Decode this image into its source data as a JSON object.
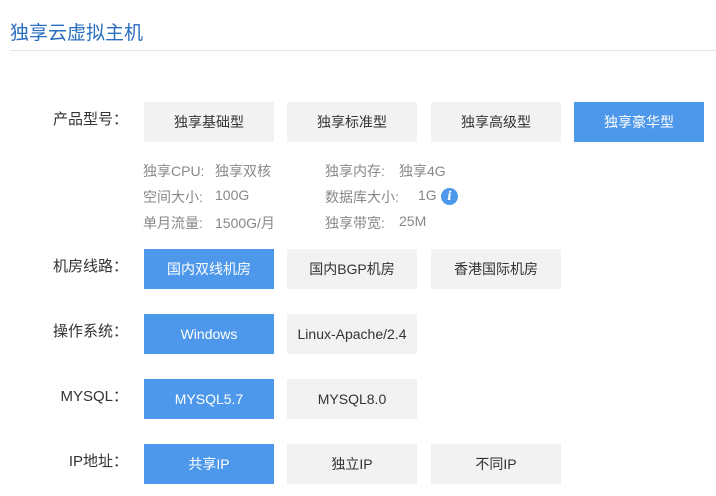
{
  "page": {
    "title": "独享云虚拟主机"
  },
  "product_model": {
    "label": "产品型号：",
    "options": [
      "独享基础型",
      "独享标准型",
      "独享高级型",
      "独享豪华型"
    ],
    "selected": "独享豪华型"
  },
  "specs": {
    "cpu": {
      "label": "独享CPU:",
      "value": "独享双核"
    },
    "memory": {
      "label": "独享内存:",
      "value": "独享4G"
    },
    "space": {
      "label": "空间大小:",
      "value": "100G"
    },
    "database": {
      "label": "数据库大小:",
      "value": "1G"
    },
    "traffic": {
      "label": "单月流量:",
      "value": "1500G/月"
    },
    "bandwidth": {
      "label": "独享带宽:",
      "value": "25M"
    },
    "info_icon_glyph": "i"
  },
  "network": {
    "label": "机房线路：",
    "options": [
      "国内双线机房",
      "国内BGP机房",
      "香港国际机房"
    ],
    "selected": "国内双线机房"
  },
  "os": {
    "label": "操作系统：",
    "options": [
      "Windows",
      "Linux-Apache/2.4"
    ],
    "selected": "Windows"
  },
  "mysql": {
    "label": "MYSQL：",
    "options": [
      "MYSQL5.7",
      "MYSQL8.0"
    ],
    "selected": "MYSQL5.7"
  },
  "ip": {
    "label": "IP地址：",
    "options": [
      "共享IP",
      "独立IP",
      "不同IP"
    ],
    "selected": "共享IP"
  },
  "colors": {
    "accent": "#4d98ea",
    "title": "#2a6ec0",
    "option_bg": "#f2f2f2"
  }
}
